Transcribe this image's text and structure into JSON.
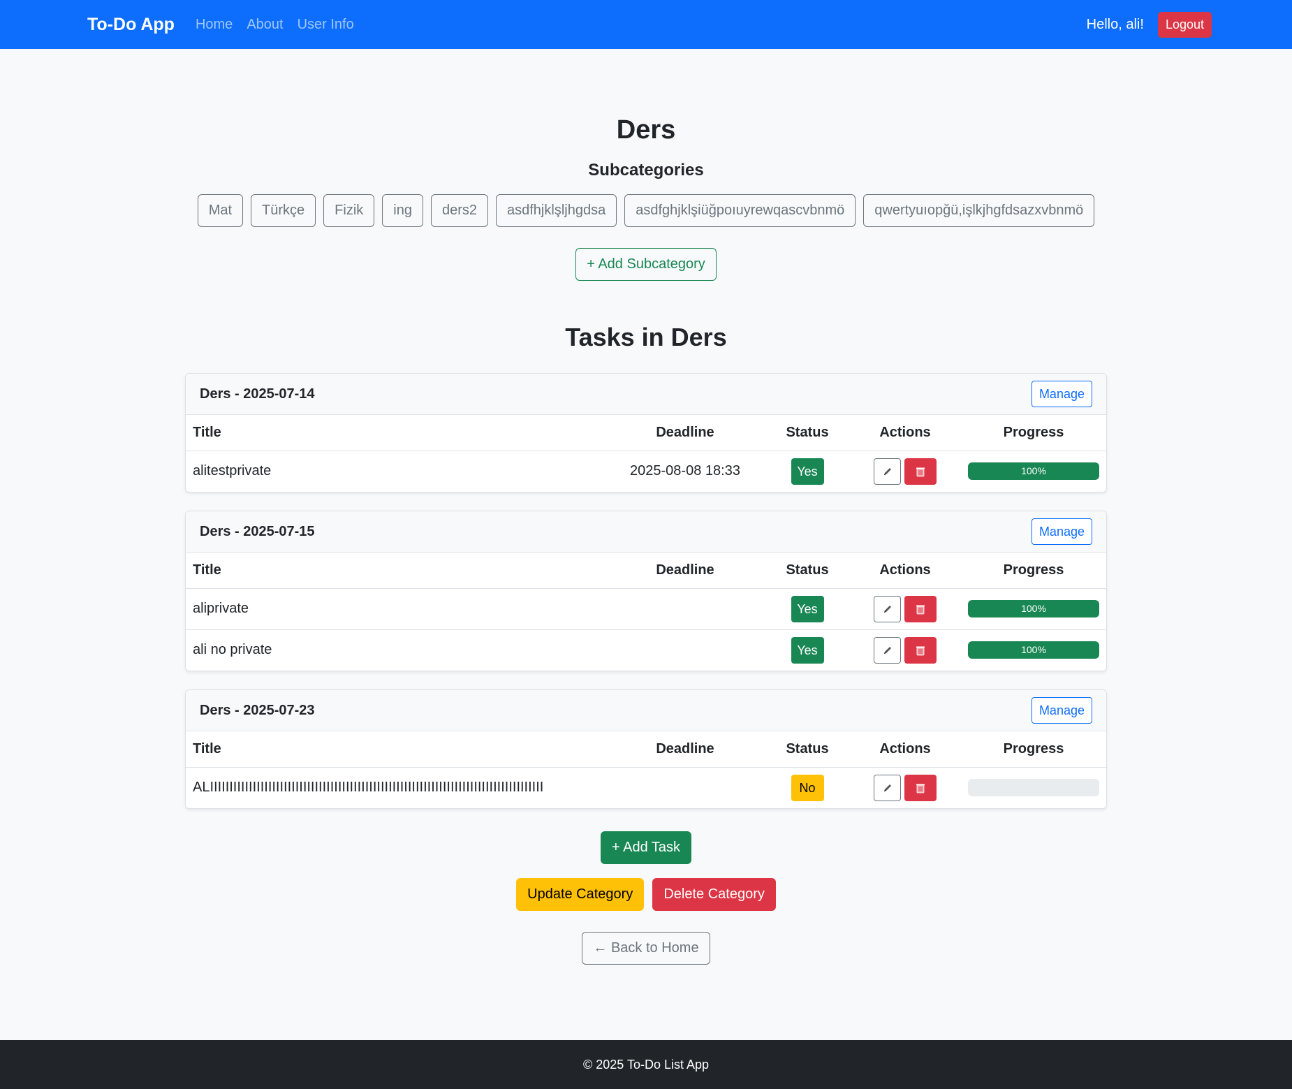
{
  "navbar": {
    "brand": "To-Do App",
    "links": [
      "Home",
      "About",
      "User Info"
    ],
    "greeting": "Hello, ali!",
    "logout": "Logout"
  },
  "category": {
    "title": "Ders",
    "subcategories_heading": "Subcategories",
    "subcategories": [
      "Mat",
      "Türkçe",
      "Fizik",
      "ing",
      "ders2",
      "asdfhjklşljhgdsa",
      "asdfghjklşiüğpoıuyrewqascvbnmö",
      "qwertyuıopğü,işlkjhgfdsazxvbnmö"
    ],
    "add_subcategory": "+ Add Subcategory",
    "tasks_heading": "Tasks in Ders"
  },
  "table_headers": {
    "title": "Title",
    "deadline": "Deadline",
    "status": "Status",
    "actions": "Actions",
    "progress": "Progress"
  },
  "manage_label": "Manage",
  "task_groups": [
    {
      "title": "Ders - 2025-07-14",
      "tasks": [
        {
          "title": "alitestprivate",
          "deadline": "2025-08-08 18:33",
          "status": "Yes",
          "progress": 100,
          "progress_label": "100%"
        }
      ]
    },
    {
      "title": "Ders - 2025-07-15",
      "tasks": [
        {
          "title": "aliprivate",
          "deadline": "",
          "status": "Yes",
          "progress": 100,
          "progress_label": "100%"
        },
        {
          "title": "ali no private",
          "deadline": "",
          "status": "Yes",
          "progress": 100,
          "progress_label": "100%"
        }
      ]
    },
    {
      "title": "Ders - 2025-07-23",
      "tasks": [
        {
          "title": "ALIIIIIIIIIIIIIIIIIIIIIIIIIIIIIIIIIIIIIIIIIIIIIIIIIIIIIIIIIIIIIIIIIIIIIIIIIIIIIIIIIIIIII",
          "deadline": "",
          "status": "No",
          "progress": 0,
          "progress_label": ""
        }
      ]
    }
  ],
  "icons": {
    "edit": "pencil-icon",
    "delete": "trash-icon"
  },
  "buttons": {
    "add_task": "+ Add Task",
    "update_category": "Update Category",
    "delete_category": "Delete Category",
    "back_home": "← Back to Home"
  },
  "footer": "© 2025 To-Do List App",
  "colors": {
    "primary": "#0d6efd",
    "success": "#198754",
    "danger": "#dc3545",
    "warning": "#ffc107",
    "dark": "#212529"
  }
}
